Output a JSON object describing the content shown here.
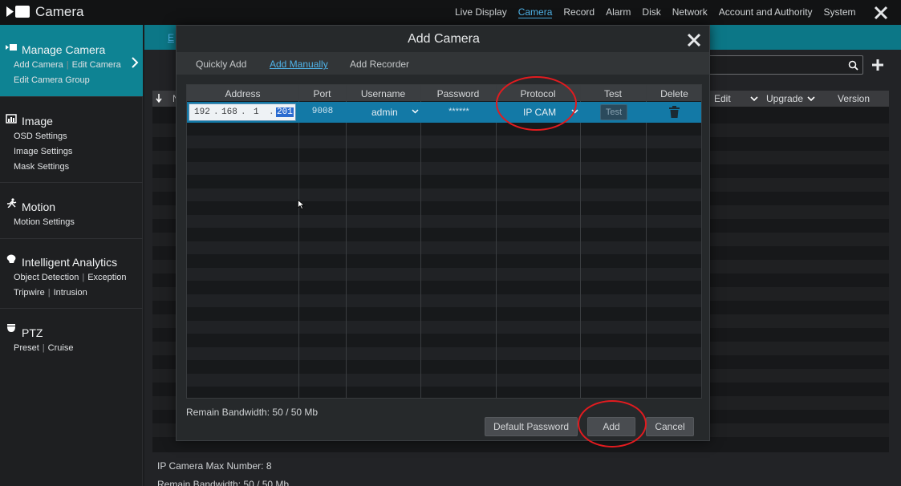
{
  "app": {
    "title": "Camera"
  },
  "topnav": [
    "Live Display",
    "Camera",
    "Record",
    "Alarm",
    "Disk",
    "Network",
    "Account and Authority",
    "System"
  ],
  "sidebar": {
    "manage": {
      "title": "Manage Camera",
      "links": [
        "Add Camera",
        "Edit Camera",
        "Edit Camera Group"
      ]
    },
    "image": {
      "title": "Image",
      "links": [
        "OSD Settings",
        "Image Settings",
        "Mask Settings"
      ]
    },
    "motion": {
      "title": "Motion",
      "links": [
        "Motion Settings"
      ]
    },
    "analytics": {
      "title": "Intelligent Analytics",
      "links": [
        "Object Detection",
        "Exception",
        "Tripwire",
        "Intrusion"
      ]
    },
    "ptz": {
      "title": "PTZ",
      "links": [
        "Preset",
        "Cruise"
      ]
    }
  },
  "background": {
    "tab_partial": "E",
    "table_headers": [
      "N",
      "Edit",
      "Upgrade",
      "Version"
    ],
    "max_number": "IP Camera Max Number: 8",
    "bandwidth": "Remain Bandwidth: 50 / 50 Mb"
  },
  "modal": {
    "title": "Add Camera",
    "tabs": [
      "Quickly Add",
      "Add Manually",
      "Add Recorder"
    ],
    "active_tab": "Add Manually",
    "columns": [
      "Address",
      "Port",
      "Username",
      "Password",
      "Protocol",
      "Test",
      "Delete"
    ],
    "row": {
      "address": [
        "192",
        "168",
        "1",
        "201"
      ],
      "port": "9008",
      "username": "admin",
      "password": "******",
      "protocol": "IP CAM",
      "test_label": "Test"
    },
    "bandwidth": "Remain Bandwidth: 50 / 50 Mb",
    "buttons": {
      "default_password": "Default Password",
      "add": "Add",
      "cancel": "Cancel"
    }
  },
  "colors": {
    "accent": "#0e8393",
    "link": "#4fb3e8",
    "selected_row": "#1379a6",
    "annotation": "#e21b1f"
  }
}
